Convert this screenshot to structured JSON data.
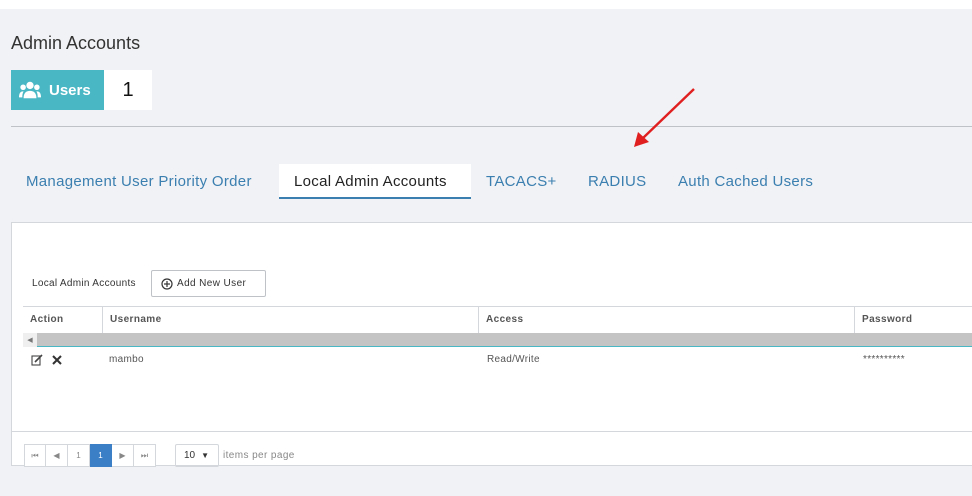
{
  "page": {
    "title": "Admin Accounts"
  },
  "users_badge": {
    "label": "Users",
    "count": "1",
    "icon": "users-icon"
  },
  "tabs": [
    {
      "label": "Management User Priority Order",
      "active": false
    },
    {
      "label": "Local Admin Accounts",
      "active": true
    },
    {
      "label": "TACACS+",
      "active": false
    },
    {
      "label": "RADIUS",
      "active": false
    },
    {
      "label": "Auth Cached Users",
      "active": false
    }
  ],
  "annotation": {
    "arrow_color": "#e02020"
  },
  "panel": {
    "section_label": "Local Admin Accounts",
    "add_button_label": "Add New User",
    "columns": [
      "Action",
      "Username",
      "Access",
      "Password"
    ],
    "rows": [
      {
        "username": "mambo",
        "access": "Read/Write",
        "password": "**********"
      }
    ]
  },
  "pager": {
    "first": "⏮",
    "prev": "◀",
    "page_1": "1",
    "current": "1",
    "next": "▶",
    "last": "⏭",
    "page_size": "10",
    "page_size_label": "items per page"
  },
  "colors": {
    "accent": "#4ab7c5",
    "link": "#3b7fb0",
    "current_page": "#3b7fc7"
  }
}
